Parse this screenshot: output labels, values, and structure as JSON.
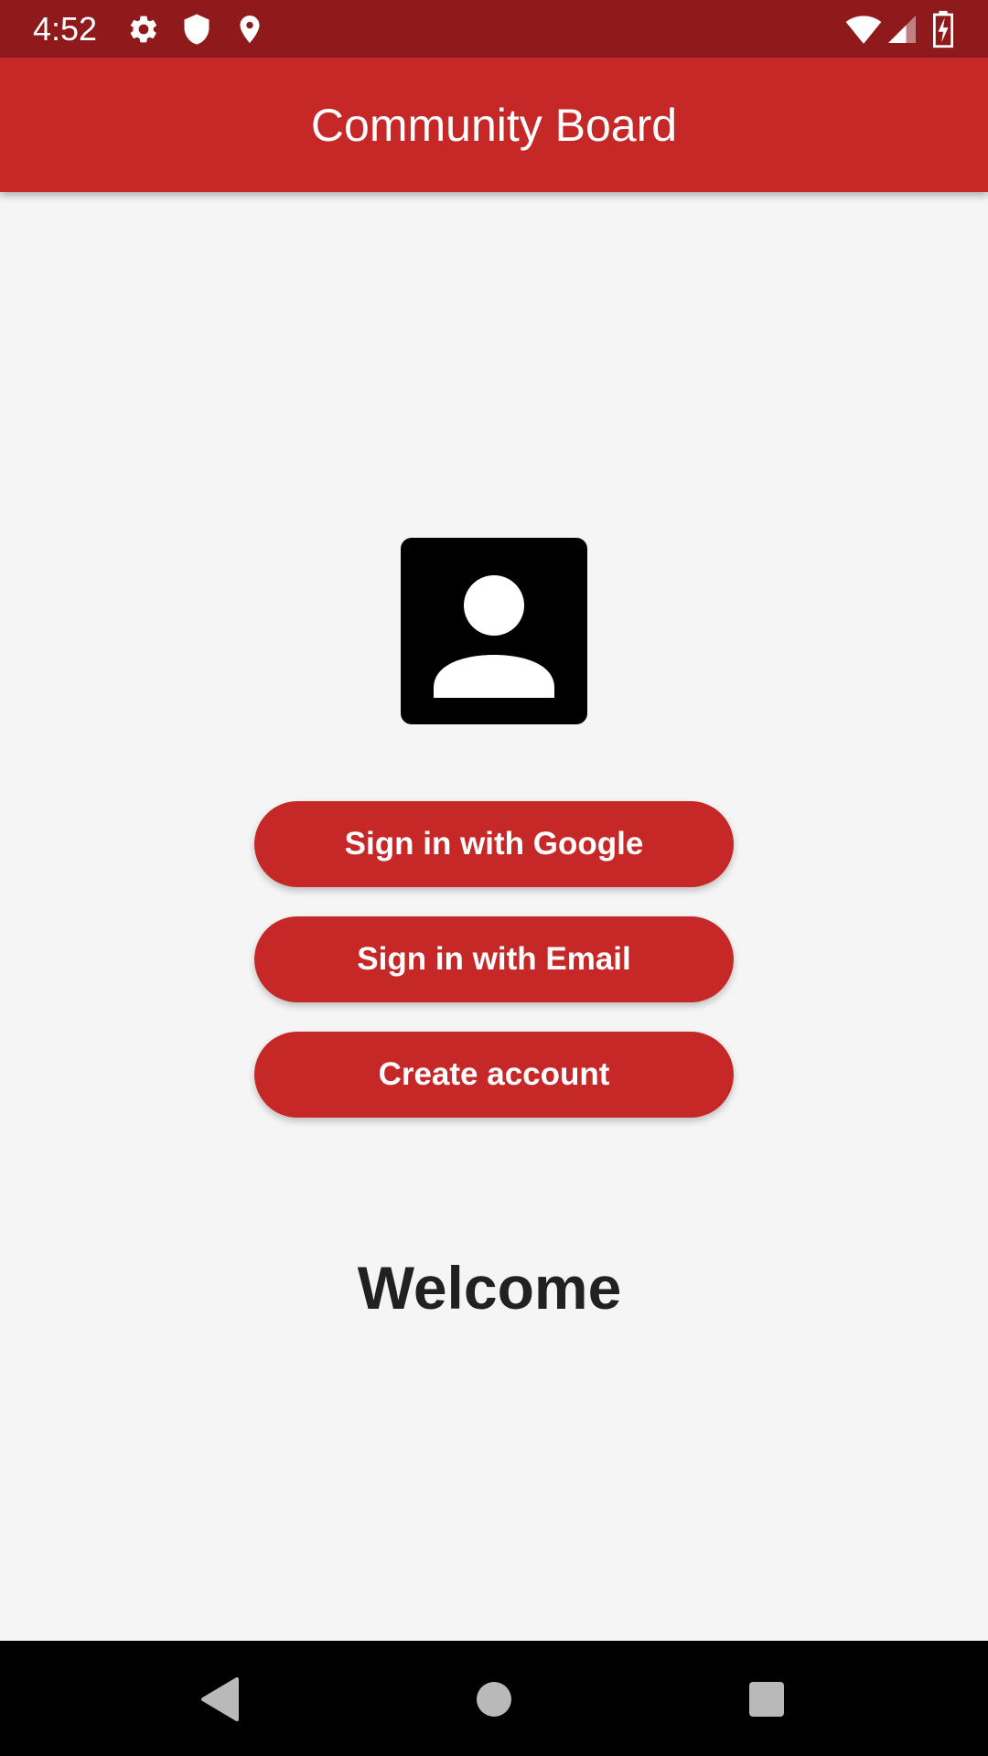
{
  "status_bar": {
    "time": "4:52",
    "icons_left": [
      "settings-icon",
      "shield-icon",
      "location-icon"
    ],
    "icons_right": [
      "wifi-icon",
      "signal-icon",
      "battery-charging-icon"
    ],
    "background_color": "#8e1a1c"
  },
  "app_bar": {
    "title": "Community Board",
    "background_color": "#c62727"
  },
  "main": {
    "avatar_icon": "account-box-icon",
    "buttons": {
      "google": "Sign in with Google",
      "email": "Sign in with Email",
      "create": "Create account"
    },
    "button_color": "#c62727",
    "welcome": "Welcome"
  },
  "nav_bar": {
    "buttons": [
      "back-icon",
      "home-icon",
      "recents-icon"
    ]
  }
}
